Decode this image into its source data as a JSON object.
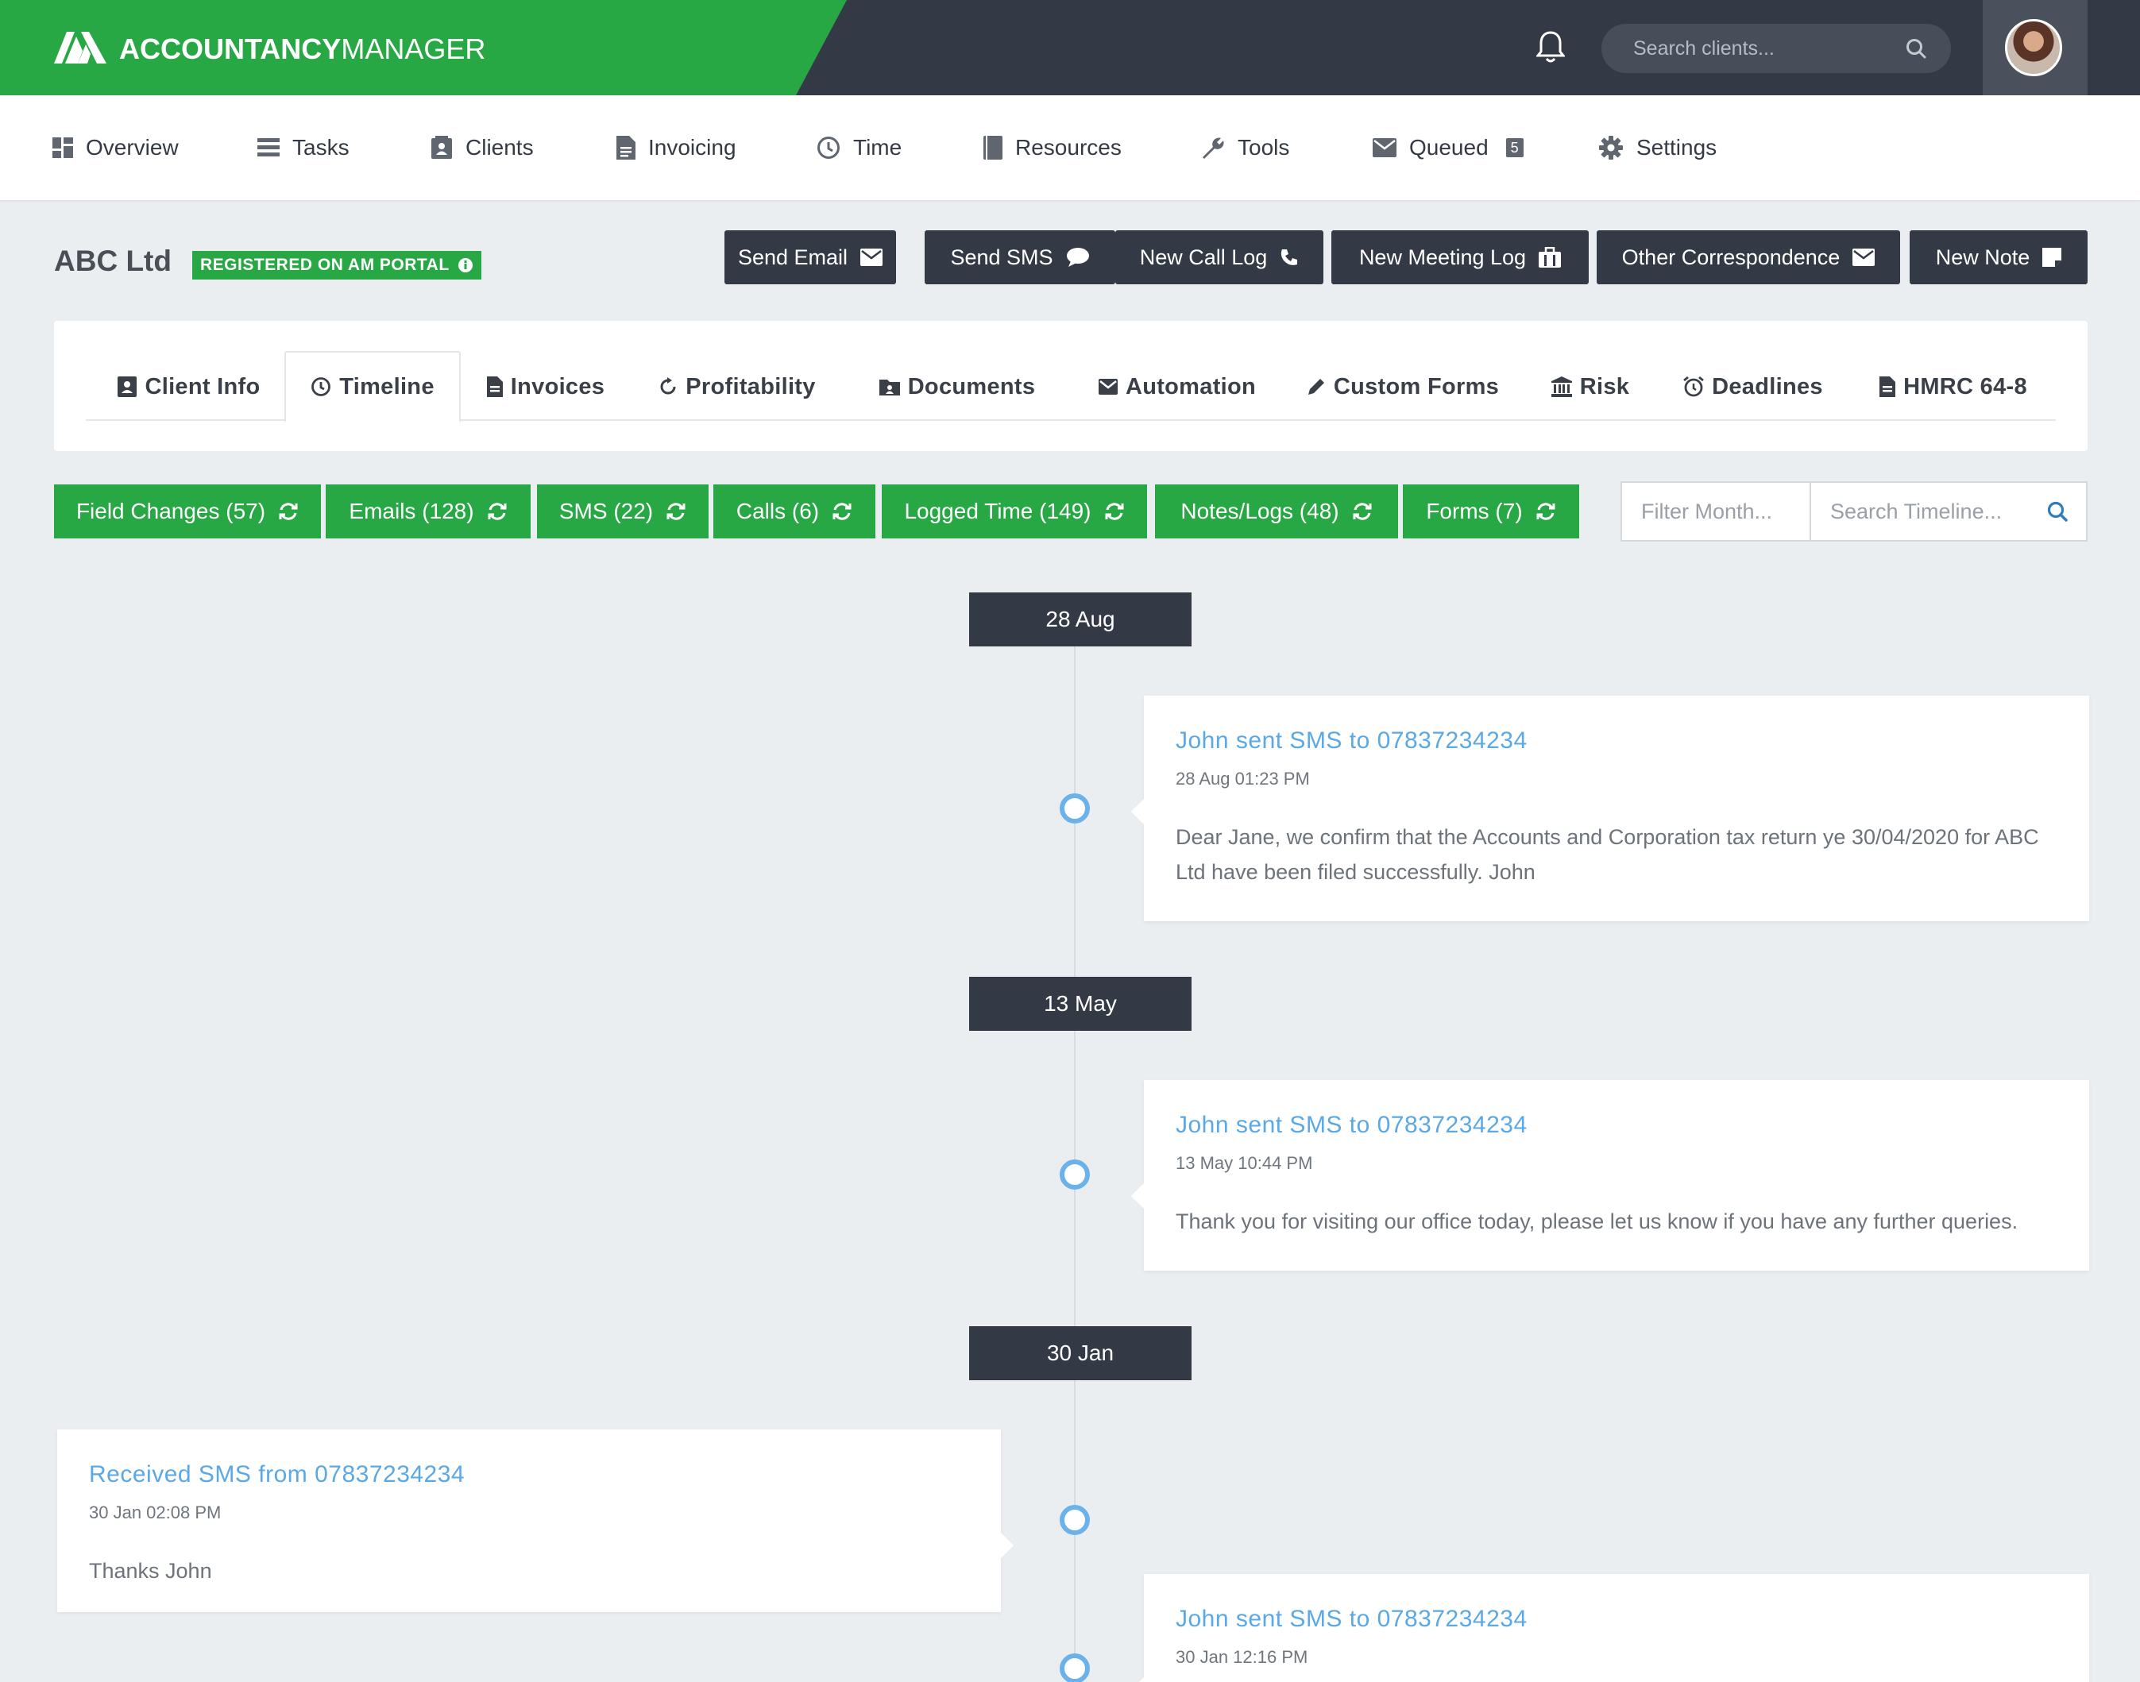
{
  "app": {
    "brand_bold": "ACCOUNTANCY",
    "brand_light": "MANAGER",
    "search_placeholder": "Search clients..."
  },
  "nav": {
    "items": [
      {
        "label": "Overview",
        "icon": "dashboard-icon"
      },
      {
        "label": "Tasks",
        "icon": "list-icon"
      },
      {
        "label": "Clients",
        "icon": "contact-card-icon"
      },
      {
        "label": "Invoicing",
        "icon": "document-icon"
      },
      {
        "label": "Time",
        "icon": "clock-icon"
      },
      {
        "label": "Resources",
        "icon": "book-icon"
      },
      {
        "label": "Tools",
        "icon": "wrench-icon"
      },
      {
        "label": "Queued",
        "icon": "envelope-icon",
        "badge": "5"
      },
      {
        "label": "Settings",
        "icon": "gear-icon"
      }
    ]
  },
  "client": {
    "name": "ABC Ltd",
    "portal_badge": "REGISTERED ON AM PORTAL"
  },
  "actions": [
    {
      "label": "Send Email",
      "icon": "envelope-icon"
    },
    {
      "label": "Send SMS",
      "icon": "chat-bubble-icon"
    },
    {
      "label": "New Call Log",
      "icon": "phone-icon"
    },
    {
      "label": "New Meeting Log",
      "icon": "briefcase-icon"
    },
    {
      "label": "Other Correspondence",
      "icon": "envelope-icon"
    },
    {
      "label": "New Note",
      "icon": "note-icon"
    }
  ],
  "tabs": [
    {
      "label": "Client Info",
      "icon": "contact-card-icon"
    },
    {
      "label": "Timeline",
      "icon": "clock-icon",
      "active": true
    },
    {
      "label": "Invoices",
      "icon": "document-icon"
    },
    {
      "label": "Profitability",
      "icon": "refresh-circle-icon"
    },
    {
      "label": "Documents",
      "icon": "folder-icon"
    },
    {
      "label": "Automation",
      "icon": "envelope-icon"
    },
    {
      "label": "Custom Forms",
      "icon": "pencil-icon"
    },
    {
      "label": "Risk",
      "icon": "bank-icon"
    },
    {
      "label": "Deadlines",
      "icon": "alarm-clock-icon"
    },
    {
      "label": "HMRC 64-8",
      "icon": "document-icon"
    }
  ],
  "filters": [
    "Field Changes (57)",
    "Emails (128)",
    "SMS (22)",
    "Calls (6)",
    "Logged Time (149)",
    "Notes/Logs (48)",
    "Forms (7)"
  ],
  "filter_month_placeholder": "Filter Month...",
  "search_timeline_placeholder": "Search Timeline...",
  "timeline": {
    "dates": [
      "28 Aug",
      "13 May",
      "30 Jan"
    ],
    "entries": [
      {
        "title": "John sent SMS to 07837234234",
        "timestamp": "28 Aug 01:23 PM",
        "body": "Dear Jane, we confirm that the Accounts and Corporation tax return ye 30/04/2020 for ABC Ltd have been filed successfully. John"
      },
      {
        "title": "John sent SMS to 07837234234",
        "timestamp": "13 May 10:44 PM",
        "body": "Thank you for visiting our office today, please let us know if you have any further queries."
      },
      {
        "title": "Received SMS from 07837234234",
        "timestamp": "30 Jan 02:08 PM",
        "body": "Thanks John"
      },
      {
        "title": "John sent SMS to 07837234234",
        "timestamp": "30 Jan 12:16 PM",
        "body": ""
      }
    ]
  },
  "colors": {
    "brand_green": "#28a745",
    "dark": "#343a45",
    "link_blue": "#5aa9e6",
    "timeline_dot": "#6cb2ea"
  }
}
